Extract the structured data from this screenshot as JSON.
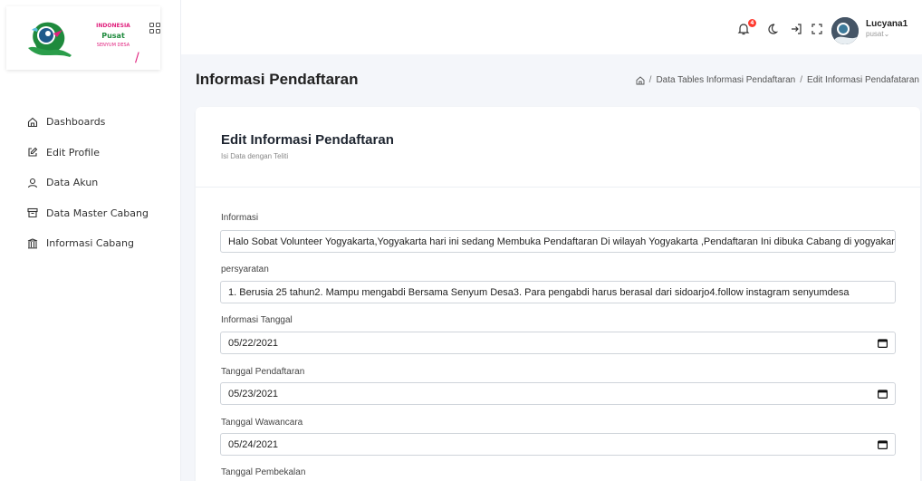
{
  "logo": {
    "line1": "INDONESIA",
    "line2": "Pusat",
    "line3": "SENYUM DESA",
    "slash": "/"
  },
  "sidebar": {
    "items": [
      {
        "label": "Dashboards",
        "icon": "home-icon"
      },
      {
        "label": "Edit Profile",
        "icon": "edit-icon"
      },
      {
        "label": "Data Akun",
        "icon": "user-icon"
      },
      {
        "label": "Data Master Cabang",
        "icon": "archive-icon"
      },
      {
        "label": "Informasi Cabang",
        "icon": "columns-icon"
      }
    ]
  },
  "topbar": {
    "notification_count": "4",
    "user_name": "Lucyana1",
    "user_role": "pusat⌄"
  },
  "page": {
    "title": "Informasi Pendaftaran",
    "breadcrumb": {
      "sep": "/",
      "item1": "Data Tables Informasi Pendaftaran",
      "item2": "Edit Informasi Pendafataran"
    }
  },
  "form": {
    "title": "Edit Informasi Pendaftaran",
    "subtitle": "Isi Data dengan Teliti",
    "fields": [
      {
        "label": "Informasi",
        "value": "Halo Sobat Volunteer Yogyakarta,Yogyakarta hari ini sedang Membuka Pendaftaran Di wilayah Yogyakarta ,Pendaftaran Ini dibuka Cabang di yogyakarta"
      },
      {
        "label": "persyaratan",
        "value": "1. Berusia 25 tahun2. Mampu mengabdi Bersama Senyum Desa3. Para pengabdi harus berasal dari sidoarjo4.follow instagram senyumdesa"
      },
      {
        "label": "Informasi Tanggal",
        "value": "05/22/2021"
      },
      {
        "label": "Tanggal Pendaftaran",
        "value": "05/23/2021"
      },
      {
        "label": "Tanggal Wawancara",
        "value": "05/24/2021"
      },
      {
        "label": "Tanggal Pembekalan",
        "value": ""
      }
    ]
  },
  "colors": {
    "accent": "#e0207d",
    "green": "#1f8a3d",
    "badge": "#ff3b30"
  }
}
